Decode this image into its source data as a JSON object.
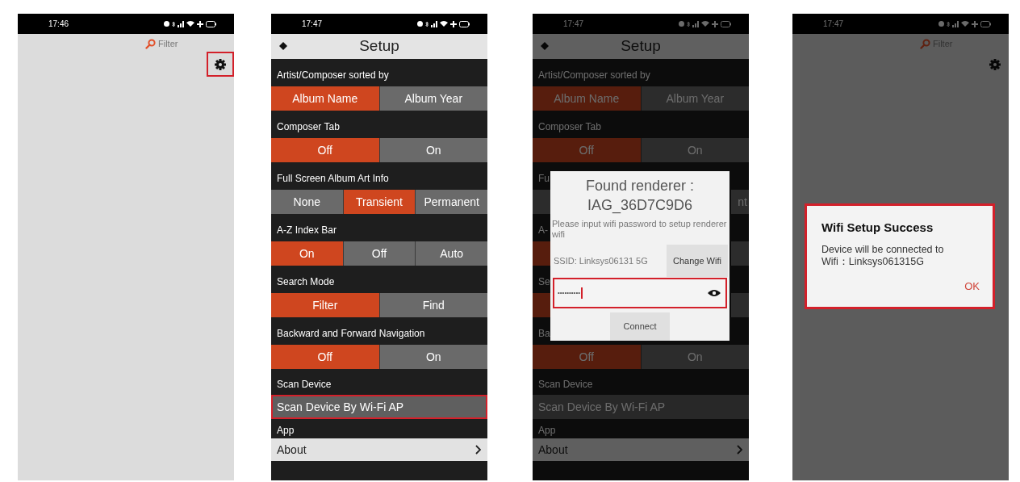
{
  "screens": [
    {
      "kind": "home",
      "dimmed": false,
      "status_bar": {
        "time": "17:46"
      },
      "search": {
        "label": "Filter"
      },
      "settings_button": {
        "highlighted": true
      }
    },
    {
      "kind": "setup",
      "dimmed": false,
      "status_bar": {
        "time": "17:47"
      },
      "title": "Setup",
      "sections": [
        {
          "label": "Artist/Composer sorted by",
          "options": [
            {
              "label": "Album Name",
              "selected": true
            },
            {
              "label": "Album Year",
              "selected": false
            }
          ]
        },
        {
          "label": "Composer Tab",
          "options": [
            {
              "label": "Off",
              "selected": true
            },
            {
              "label": "On",
              "selected": false
            }
          ]
        },
        {
          "label": "Full Screen Album Art Info",
          "options": [
            {
              "label": "None",
              "selected": false
            },
            {
              "label": "Transient",
              "selected": true
            },
            {
              "label": "Permanent",
              "selected": false
            }
          ]
        },
        {
          "label": "A-Z Index Bar",
          "options": [
            {
              "label": "On",
              "selected": true
            },
            {
              "label": "Off",
              "selected": false
            },
            {
              "label": "Auto",
              "selected": false
            }
          ]
        },
        {
          "label": "Search Mode",
          "options": [
            {
              "label": "Filter",
              "selected": true
            },
            {
              "label": "Find",
              "selected": false
            }
          ]
        },
        {
          "label": "Backward and Forward Navigation",
          "options": [
            {
              "label": "Off",
              "selected": true
            },
            {
              "label": "On",
              "selected": false
            }
          ]
        }
      ],
      "scan": {
        "label": "Scan Device",
        "item": {
          "label": "Scan Device By Wi-Fi AP",
          "highlighted": true
        }
      },
      "app": {
        "label": "App",
        "item": {
          "label": "About"
        }
      }
    },
    {
      "kind": "setup",
      "dimmed": true,
      "status_bar": {
        "time": "17:47"
      },
      "title": "Setup",
      "sections": [
        {
          "label": "Artist/Composer sorted by",
          "options": [
            {
              "label": "Album Name",
              "selected": true
            },
            {
              "label": "Album Year",
              "selected": false
            }
          ]
        },
        {
          "label": "Composer Tab",
          "options": [
            {
              "label": "Off",
              "selected": true
            },
            {
              "label": "On",
              "selected": false
            }
          ]
        },
        {
          "label": "Fu",
          "options": [
            {
              "selected": false
            },
            {
              "label": "nt",
              "selected": false,
              "clipped": true
            }
          ]
        },
        {
          "label": "A-",
          "options": [
            {
              "selected": true
            },
            {
              "selected": false
            }
          ]
        },
        {
          "label": "Se",
          "options": [
            {
              "selected": true
            },
            {
              "selected": false
            }
          ]
        },
        {
          "label": "Ba",
          "options": [
            {
              "label": "Off",
              "selected": true
            },
            {
              "label": "On",
              "selected": false
            }
          ]
        }
      ],
      "scan": {
        "label": "Scan Device",
        "item": {
          "label": "Scan Device By Wi-Fi AP",
          "highlighted": false
        }
      },
      "app": {
        "label": "App",
        "item": {
          "label": "About"
        }
      },
      "dialog": {
        "kind": "renderer",
        "title": "Found renderer : IAG_36D7C9D6",
        "message": "Please input wifi password to setup renderer wifi",
        "ssid": "SSID: Linksys06131 5G",
        "change_button": "Change Wifi",
        "password": {
          "value": "••••••••••",
          "highlighted": true
        },
        "connect_button": "Connect"
      }
    },
    {
      "kind": "home",
      "dimmed": true,
      "status_bar": {
        "time": "17:47"
      },
      "search": {
        "label": "Filter"
      },
      "settings_button": {
        "highlighted": false
      },
      "dialog": {
        "kind": "message",
        "highlighted": true,
        "title": "Wifi Setup Success",
        "message": "Device will be connected to Wifi：Linksys061315G",
        "ok_button": "OK"
      }
    }
  ]
}
